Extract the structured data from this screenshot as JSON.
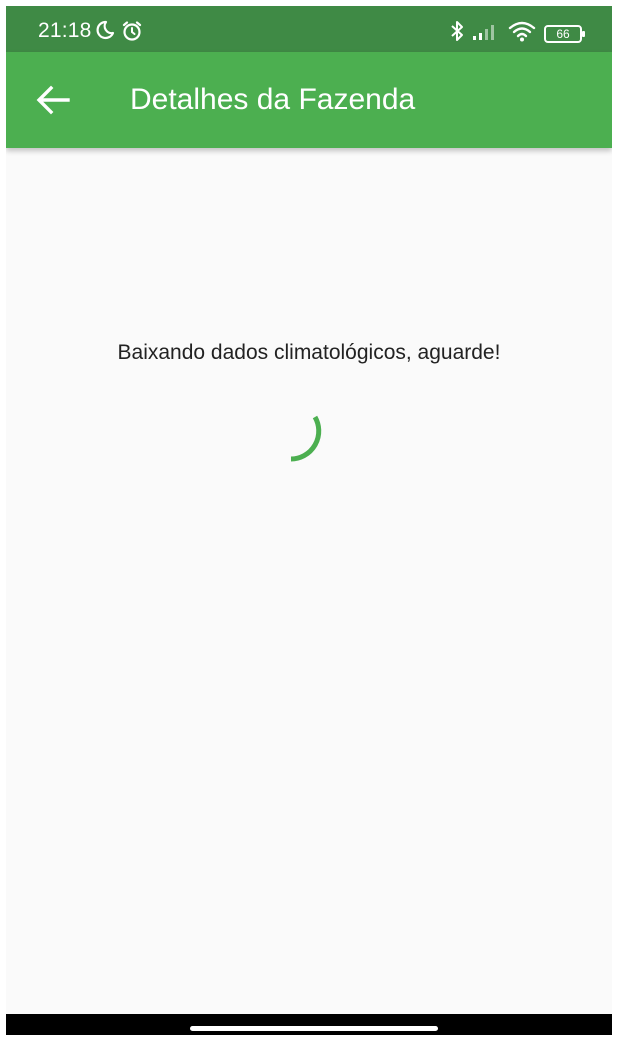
{
  "status_bar": {
    "time": "21:18",
    "battery": "66",
    "icons": [
      "moon-icon",
      "alarm-icon",
      "bluetooth-icon",
      "signal-icon",
      "wifi-icon",
      "battery-icon"
    ]
  },
  "app_bar": {
    "title": "Detalhes da Fazenda",
    "back_icon": "back-arrow-icon"
  },
  "content": {
    "loading_message": "Baixando dados climatológicos, aguarde!"
  },
  "colors": {
    "status_bar": "#3f8a45",
    "app_bar": "#4caf50",
    "spinner": "#4caf50",
    "background": "#fafafa"
  }
}
